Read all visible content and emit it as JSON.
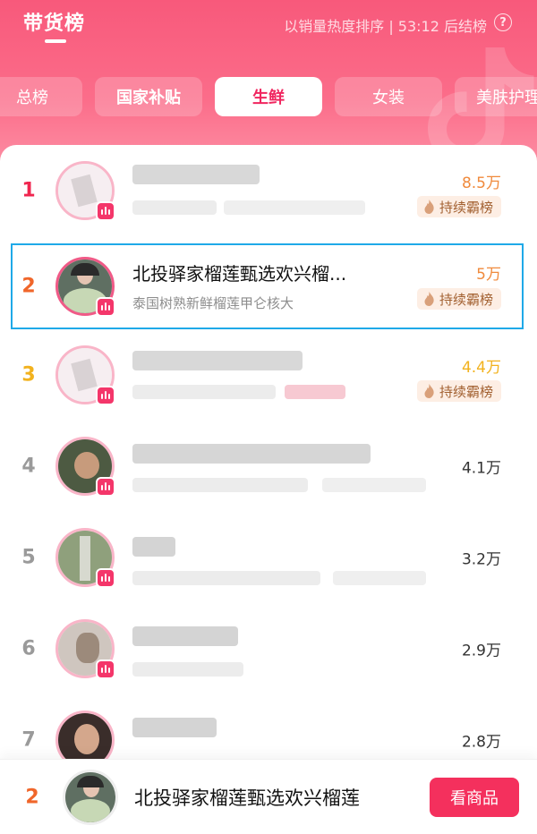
{
  "header": {
    "title": "带货榜",
    "subtitle": "以销量热度排序 | 53:12 后结榜",
    "help": "?"
  },
  "tabs": [
    {
      "label": "总榜"
    },
    {
      "label": "国家补贴"
    },
    {
      "label": "生鲜"
    },
    {
      "label": "女装"
    },
    {
      "label": "美肤护理"
    }
  ],
  "active_tab": "生鲜",
  "list": [
    {
      "rank": "1",
      "name": "",
      "desc": "",
      "value": "8.5万",
      "badge": "持续霸榜"
    },
    {
      "rank": "2",
      "name": "北投驿家榴莲甄选欢兴榴...",
      "desc": "泰国树熟新鲜榴莲甲仑核大",
      "value": "5万",
      "badge": "持续霸榜"
    },
    {
      "rank": "3",
      "name": "",
      "desc": "",
      "value": "4.4万",
      "badge": "持续霸榜"
    },
    {
      "rank": "4",
      "name": "",
      "desc": "",
      "value": "4.1万"
    },
    {
      "rank": "5",
      "name": "",
      "desc": "",
      "value": "3.2万"
    },
    {
      "rank": "6",
      "name": "",
      "desc": "",
      "value": "2.9万"
    },
    {
      "rank": "7",
      "name": "",
      "desc": "",
      "value": "2.8万"
    }
  ],
  "footer": {
    "rank": "2",
    "name": "北投驿家榴莲甄选欢兴榴莲",
    "cta": "看商品"
  },
  "colors": {
    "accent": "#f4305d",
    "rank1": "#f0264f",
    "rank2": "#f0662a",
    "rank3": "#f2b21e",
    "rank_other": "#9a9a9a",
    "value_top": "#f08a3c",
    "value_third": "#f2b21e",
    "highlight_border": "#1fa9e8"
  }
}
